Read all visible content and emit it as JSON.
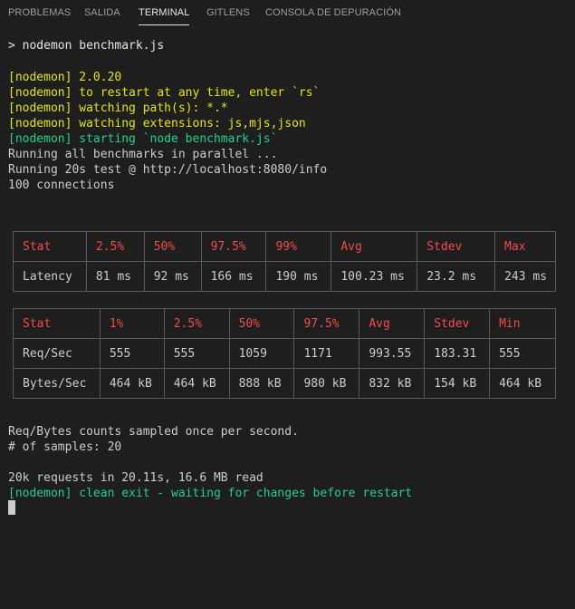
{
  "tabs": [
    "PROBLEMAS",
    "SALIDA",
    "TERMINAL",
    "GITLENS",
    "CONSOLA DE DEPURACIÓN"
  ],
  "terminal": {
    "command": "> nodemon benchmark.js",
    "nodemon_version": "[nodemon] 2.0.20",
    "nodemon_restart_hint": "[nodemon] to restart at any time, enter `rs`",
    "nodemon_watching_paths": "[nodemon] watching path(s): *.*",
    "nodemon_watching_ext": "[nodemon] watching extensions: js,mjs,json",
    "nodemon_starting": "[nodemon] starting `node benchmark.js`",
    "running_all": "Running all benchmarks in parallel ...",
    "running_test": "Running 20s test @ http://localhost:8080/info",
    "connections": "100 connections",
    "samples_note": "Req/Bytes counts sampled once per second.",
    "samples_count": "# of samples: 20",
    "summary": "20k requests in 20.11s, 16.6 MB read",
    "clean_exit": "[nodemon] clean exit - waiting for changes before restart"
  },
  "latency_table": {
    "headers": [
      "Stat",
      "2.5%",
      "50%",
      "97.5%",
      "99%",
      "Avg",
      "Stdev",
      "Max"
    ],
    "rows": [
      [
        "Latency",
        "81 ms",
        "92 ms",
        "166 ms",
        "190 ms",
        "100.23 ms",
        "23.2 ms",
        "243 ms"
      ]
    ]
  },
  "throughput_table": {
    "headers": [
      "Stat",
      "1%",
      "2.5%",
      "50%",
      "97.5%",
      "Avg",
      "Stdev",
      "Min"
    ],
    "rows": [
      [
        "Req/Sec",
        "555",
        "555",
        "1059",
        "1171",
        "993.55",
        "183.31",
        "555"
      ],
      [
        "Bytes/Sec",
        "464 kB",
        "464 kB",
        "888 kB",
        "980 kB",
        "832 kB",
        "154 kB",
        "464 kB"
      ]
    ]
  },
  "colors": {
    "background": "#1e1e1e",
    "text": "#cccccc",
    "nodemon_yellow": "#e5e510",
    "nodemon_green": "#23d18b",
    "table_header_red": "#f14c4c",
    "table_border": "#5a5a5a"
  }
}
